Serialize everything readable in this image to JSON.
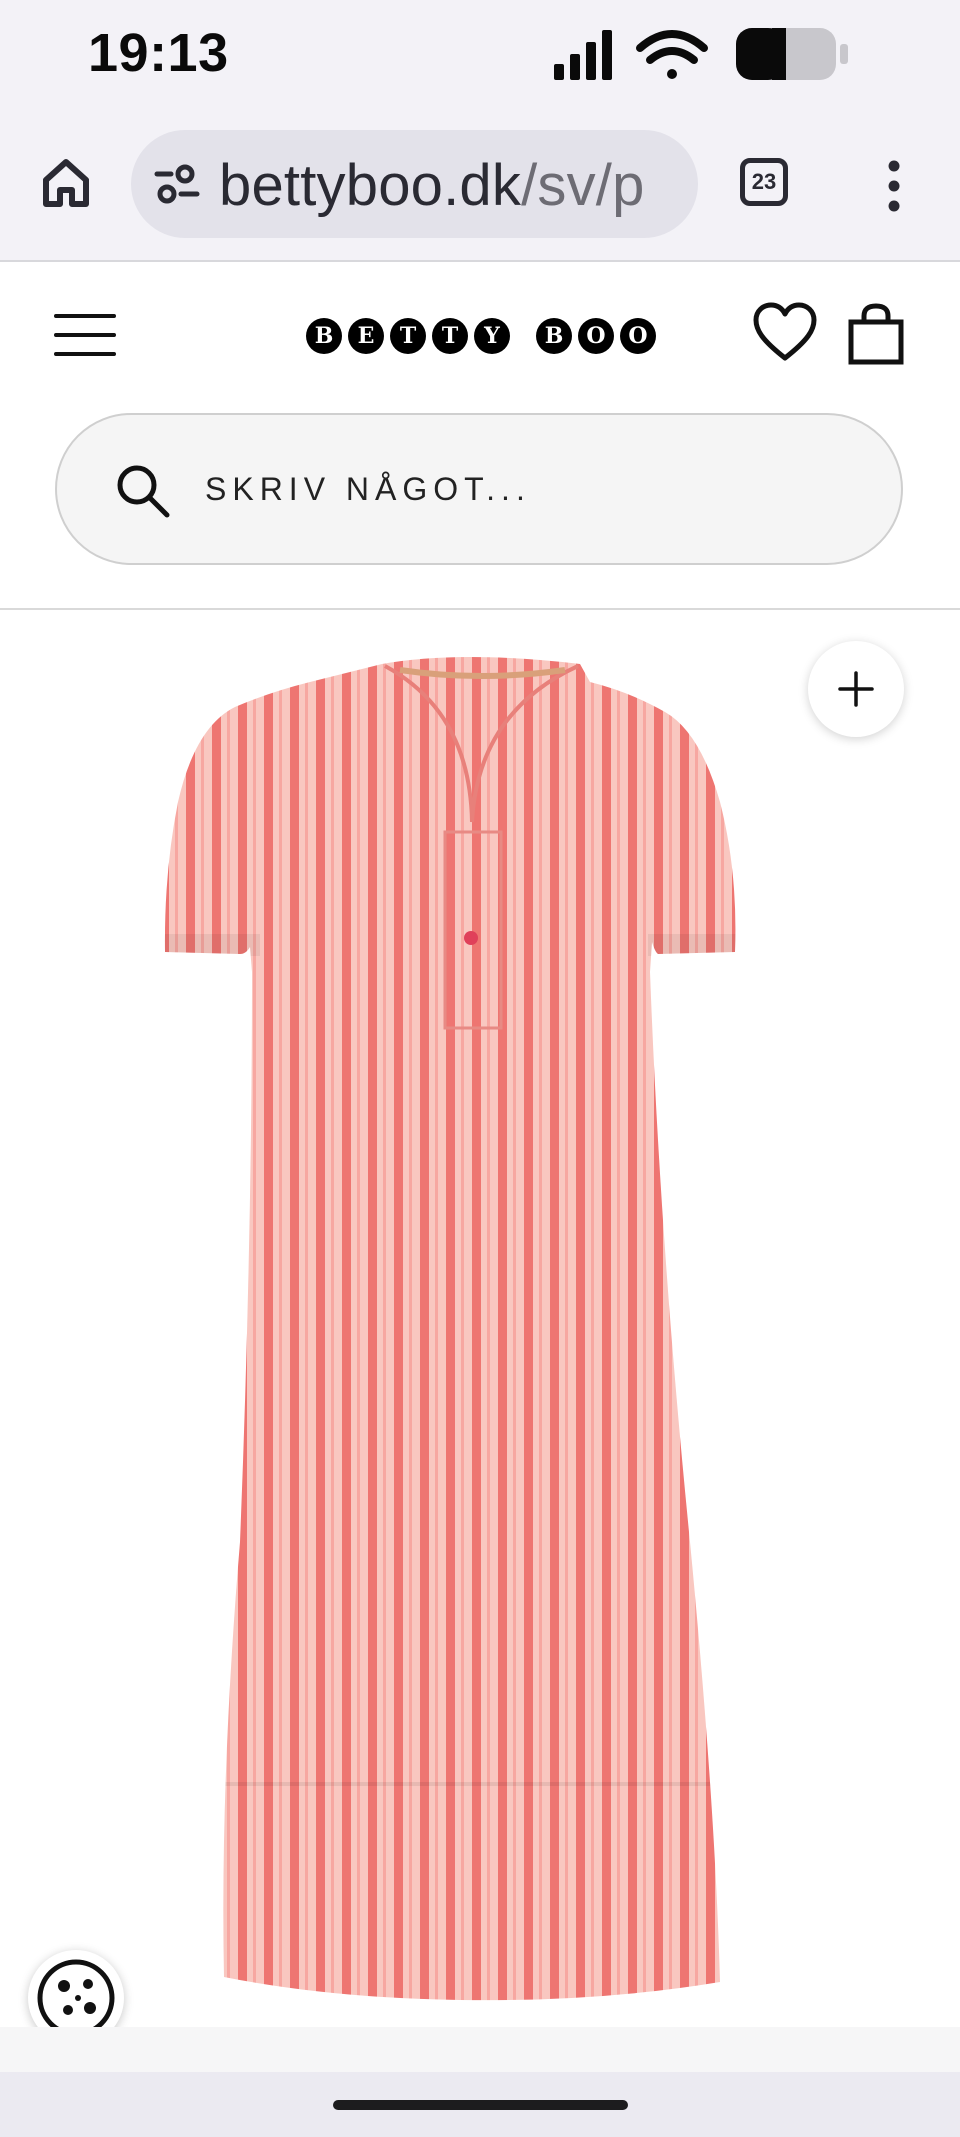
{
  "status_bar": {
    "time": "19:13",
    "icons": [
      "signal-icon",
      "wifi-icon",
      "battery-icon"
    ]
  },
  "browser": {
    "url_host": "bettyboo.dk",
    "url_path": "/sv/p",
    "tab_count": "23",
    "icons": [
      "home-icon",
      "site-settings-icon",
      "more-vertical-icon"
    ]
  },
  "header": {
    "logo_text": "BETTY BOO",
    "logo_letters": [
      "B",
      "E",
      "T",
      "T",
      "Y",
      "B",
      "O",
      "O"
    ],
    "icons": [
      "hamburger-menu-icon",
      "heart-icon",
      "shopping-bag-icon"
    ]
  },
  "search": {
    "placeholder": "SKRIV NÅGOT..."
  },
  "product": {
    "image_icons": [
      "plus-icon",
      "cookie-icon"
    ],
    "colors": {
      "dress_base": "#f7b5ad",
      "dress_stripe": "#ee6e6a",
      "accent": "#000000"
    }
  }
}
